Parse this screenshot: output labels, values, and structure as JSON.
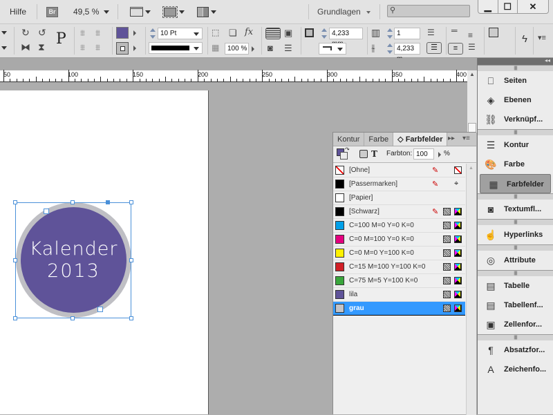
{
  "appbar": {
    "menu_help": "Hilfe",
    "bridge_label": "Br",
    "zoom_level": "49,5 %",
    "workspace": "Grundlagen",
    "search_placeholder": "",
    "window_buttons": {
      "minimize": "▁",
      "maximize": "☐",
      "close": "✕"
    }
  },
  "controlbar": {
    "reference_point_label": "P",
    "stroke_weight": "10 Pt",
    "opacity": "100 %",
    "corner_size": "4,233 mm",
    "columns": "1",
    "gutter": "4,233 m",
    "fill_color": "#5f5399",
    "stroke_color": "#000000"
  },
  "ruler": {
    "labels": [
      "50",
      "100",
      "150",
      "200",
      "250",
      "300",
      "350",
      "400"
    ]
  },
  "canvas": {
    "badge_line1": "Kalender",
    "badge_line2": "2013",
    "badge_fill": "#5f5399",
    "badge_ring": "#bfbfc4"
  },
  "swatches_panel": {
    "tabs": [
      {
        "label": "Kontur",
        "active": false
      },
      {
        "label": "Farbe",
        "active": false
      },
      {
        "label": "◇ Farbfelder",
        "active": true
      }
    ],
    "tint_label": "Farbton:",
    "tint_value": "100",
    "tint_unit": "%",
    "text_icon": "T",
    "swatches": [
      {
        "name": "[Ohne]",
        "color": "none",
        "selected": false
      },
      {
        "name": "[Passermarken]",
        "color": "#000000",
        "selected": false
      },
      {
        "name": "[Papier]",
        "color": "#ffffff",
        "selected": false
      },
      {
        "name": "[Schwarz]",
        "color": "#000000",
        "selected": false
      },
      {
        "name": "C=100 M=0 Y=0 K=0",
        "color": "#00a0e9",
        "selected": false
      },
      {
        "name": "C=0 M=100 Y=0 K=0",
        "color": "#e4007f",
        "selected": false
      },
      {
        "name": "C=0 M=0 Y=100 K=0",
        "color": "#fff100",
        "selected": false
      },
      {
        "name": "C=15 M=100 Y=100 K=0",
        "color": "#d11f26",
        "selected": false
      },
      {
        "name": "C=75 M=5 Y=100 K=0",
        "color": "#3aa63c",
        "selected": false
      },
      {
        "name": "lila",
        "color": "#5f5399",
        "selected": false
      },
      {
        "name": "grau",
        "color": "#c4c4c8",
        "selected": true
      }
    ]
  },
  "dock": {
    "groups": [
      [
        {
          "label": "Seiten",
          "icon": "pages-icon"
        },
        {
          "label": "Ebenen",
          "icon": "layers-icon"
        },
        {
          "label": "Verknüpf...",
          "icon": "links-icon"
        }
      ],
      [
        {
          "label": "Kontur",
          "icon": "stroke-icon"
        },
        {
          "label": "Farbe",
          "icon": "color-icon"
        },
        {
          "label": "Farbfelder",
          "icon": "swatches-icon",
          "active": true
        }
      ],
      [
        {
          "label": "Textumfl...",
          "icon": "text-wrap-icon"
        }
      ],
      [
        {
          "label": "Hyperlinks",
          "icon": "hyperlinks-icon"
        }
      ],
      [
        {
          "label": "Attribute",
          "icon": "attributes-icon"
        }
      ],
      [
        {
          "label": "Tabelle",
          "icon": "table-icon"
        },
        {
          "label": "Tabellenf...",
          "icon": "table-styles-icon"
        },
        {
          "label": "Zellenfor...",
          "icon": "cell-styles-icon"
        }
      ],
      [
        {
          "label": "Absatzfor...",
          "icon": "paragraph-styles-icon"
        },
        {
          "label": "Zeichenfo...",
          "icon": "character-styles-icon"
        }
      ]
    ]
  }
}
